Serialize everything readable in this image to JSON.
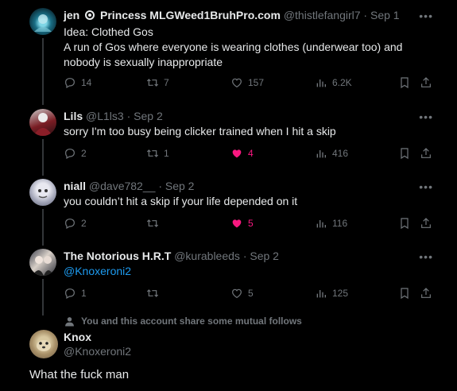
{
  "tweets": [
    {
      "name": "jen",
      "display_extra": "Princess MLGWeed1BruhPro.com",
      "handle": "@thistlefangirl7",
      "date": "Sep 1",
      "lines": [
        "Idea: Clothed Gos",
        "A run of Gos where everyone is wearing clothes (underwear too) and",
        "nobody is sexually inappropriate"
      ],
      "replies": "14",
      "retweets": "7",
      "likes": "157",
      "views": "6.2K",
      "liked": false
    },
    {
      "name": "Lils",
      "handle": "@L1ls3",
      "date": "Sep 2",
      "lines": [
        "sorry I'm too busy being clicker trained when I hit a skip"
      ],
      "replies": "2",
      "retweets": "1",
      "likes": "4",
      "views": "416",
      "liked": true
    },
    {
      "name": "niall",
      "handle": "@dave782__",
      "date": "Sep 2",
      "lines": [
        "you couldn’t hit a skip if your life depended on it"
      ],
      "replies": "2",
      "retweets": "",
      "likes": "5",
      "views": "116",
      "liked": true
    },
    {
      "name": "The Notorious H.R.T",
      "handle": "@kurableeds",
      "date": "Sep 2",
      "mention": "@Knoxeroni2",
      "replies": "1",
      "retweets": "",
      "likes": "5",
      "views": "125",
      "liked": false
    }
  ],
  "social_context": "You and this account share some mutual follows",
  "focused": {
    "name": "Knox",
    "handle": "@Knoxeroni2",
    "text": "What the fuck man"
  },
  "colors": {
    "accent": "#1d9bf0",
    "like": "#f91880",
    "muted": "#71767b"
  }
}
